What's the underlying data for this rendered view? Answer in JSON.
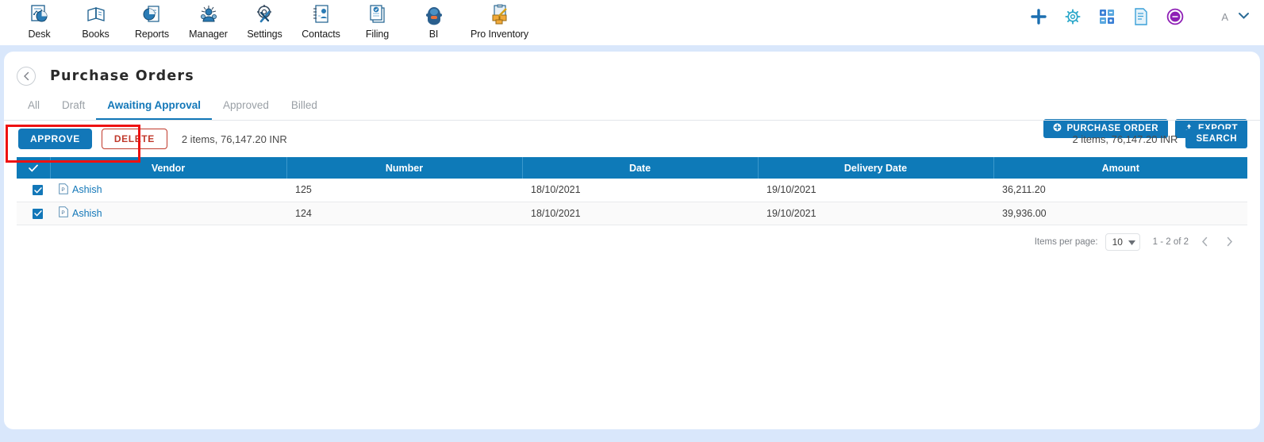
{
  "topnav": {
    "apps": [
      {
        "label": "Desk",
        "icon": "desk-icon"
      },
      {
        "label": "Books",
        "icon": "books-icon"
      },
      {
        "label": "Reports",
        "icon": "reports-icon"
      },
      {
        "label": "Manager",
        "icon": "manager-icon"
      },
      {
        "label": "Settings",
        "icon": "settings-icon"
      },
      {
        "label": "Contacts",
        "icon": "contacts-icon"
      },
      {
        "label": "Filing",
        "icon": "filing-icon"
      },
      {
        "label": "BI",
        "icon": "bi-icon"
      },
      {
        "label": "Pro Inventory",
        "icon": "pro-inventory-icon"
      }
    ],
    "right_icons": [
      {
        "name": "add-plus-icon",
        "color": "#1c6fb0"
      },
      {
        "name": "gear-icon",
        "color": "#2aa7c9"
      },
      {
        "name": "apps-grid-icon",
        "color": "#3a7fd5"
      },
      {
        "name": "document-icon",
        "color": "#3aa0d8"
      },
      {
        "name": "support-badge-icon",
        "color": "#8e1fb5"
      }
    ],
    "user_initial": "A",
    "user_chevron": "chevron-down-icon"
  },
  "page": {
    "back_label": "‹",
    "title": "Purchase Orders",
    "buttons": {
      "purchase_order": "PURCHASE ORDER",
      "export": "EXPORT"
    }
  },
  "tabs": [
    {
      "label": "All",
      "active": false
    },
    {
      "label": "Draft",
      "active": false
    },
    {
      "label": "Awaiting Approval",
      "active": true
    },
    {
      "label": "Approved",
      "active": false
    },
    {
      "label": "Billed",
      "active": false
    }
  ],
  "actions": {
    "approve": "APPROVE",
    "delete": "DELETE",
    "summary_left": "2 items, 76,147.20 INR",
    "summary_right": "2 items, 76,147.20 INR",
    "search": "SEARCH",
    "highlight_color": "#ee1111"
  },
  "table": {
    "columns": [
      "Vendor",
      "Number",
      "Date",
      "Delivery Date",
      "Amount"
    ],
    "header_checkbox_checked": true,
    "rows": [
      {
        "checked": true,
        "vendor": "Ashish",
        "vendor_icon": "po-document-icon",
        "number": "125",
        "date": "18/10/2021",
        "delivery_date": "19/10/2021",
        "amount": "36,211.20"
      },
      {
        "checked": true,
        "vendor": "Ashish",
        "vendor_icon": "po-document-icon",
        "number": "124",
        "date": "18/10/2021",
        "delivery_date": "19/10/2021",
        "amount": "39,936.00"
      }
    ]
  },
  "pagination": {
    "items_per_page_label": "Items per page:",
    "items_per_page_value": "10",
    "range": "1 - 2 of 2",
    "prev_icon": "chevron-left-icon",
    "next_icon": "chevron-right-icon"
  },
  "colors": {
    "primary": "#1277b8",
    "header": "#0e7ab8",
    "danger": "#c0392b",
    "page_bg": "#d9e7fb"
  }
}
